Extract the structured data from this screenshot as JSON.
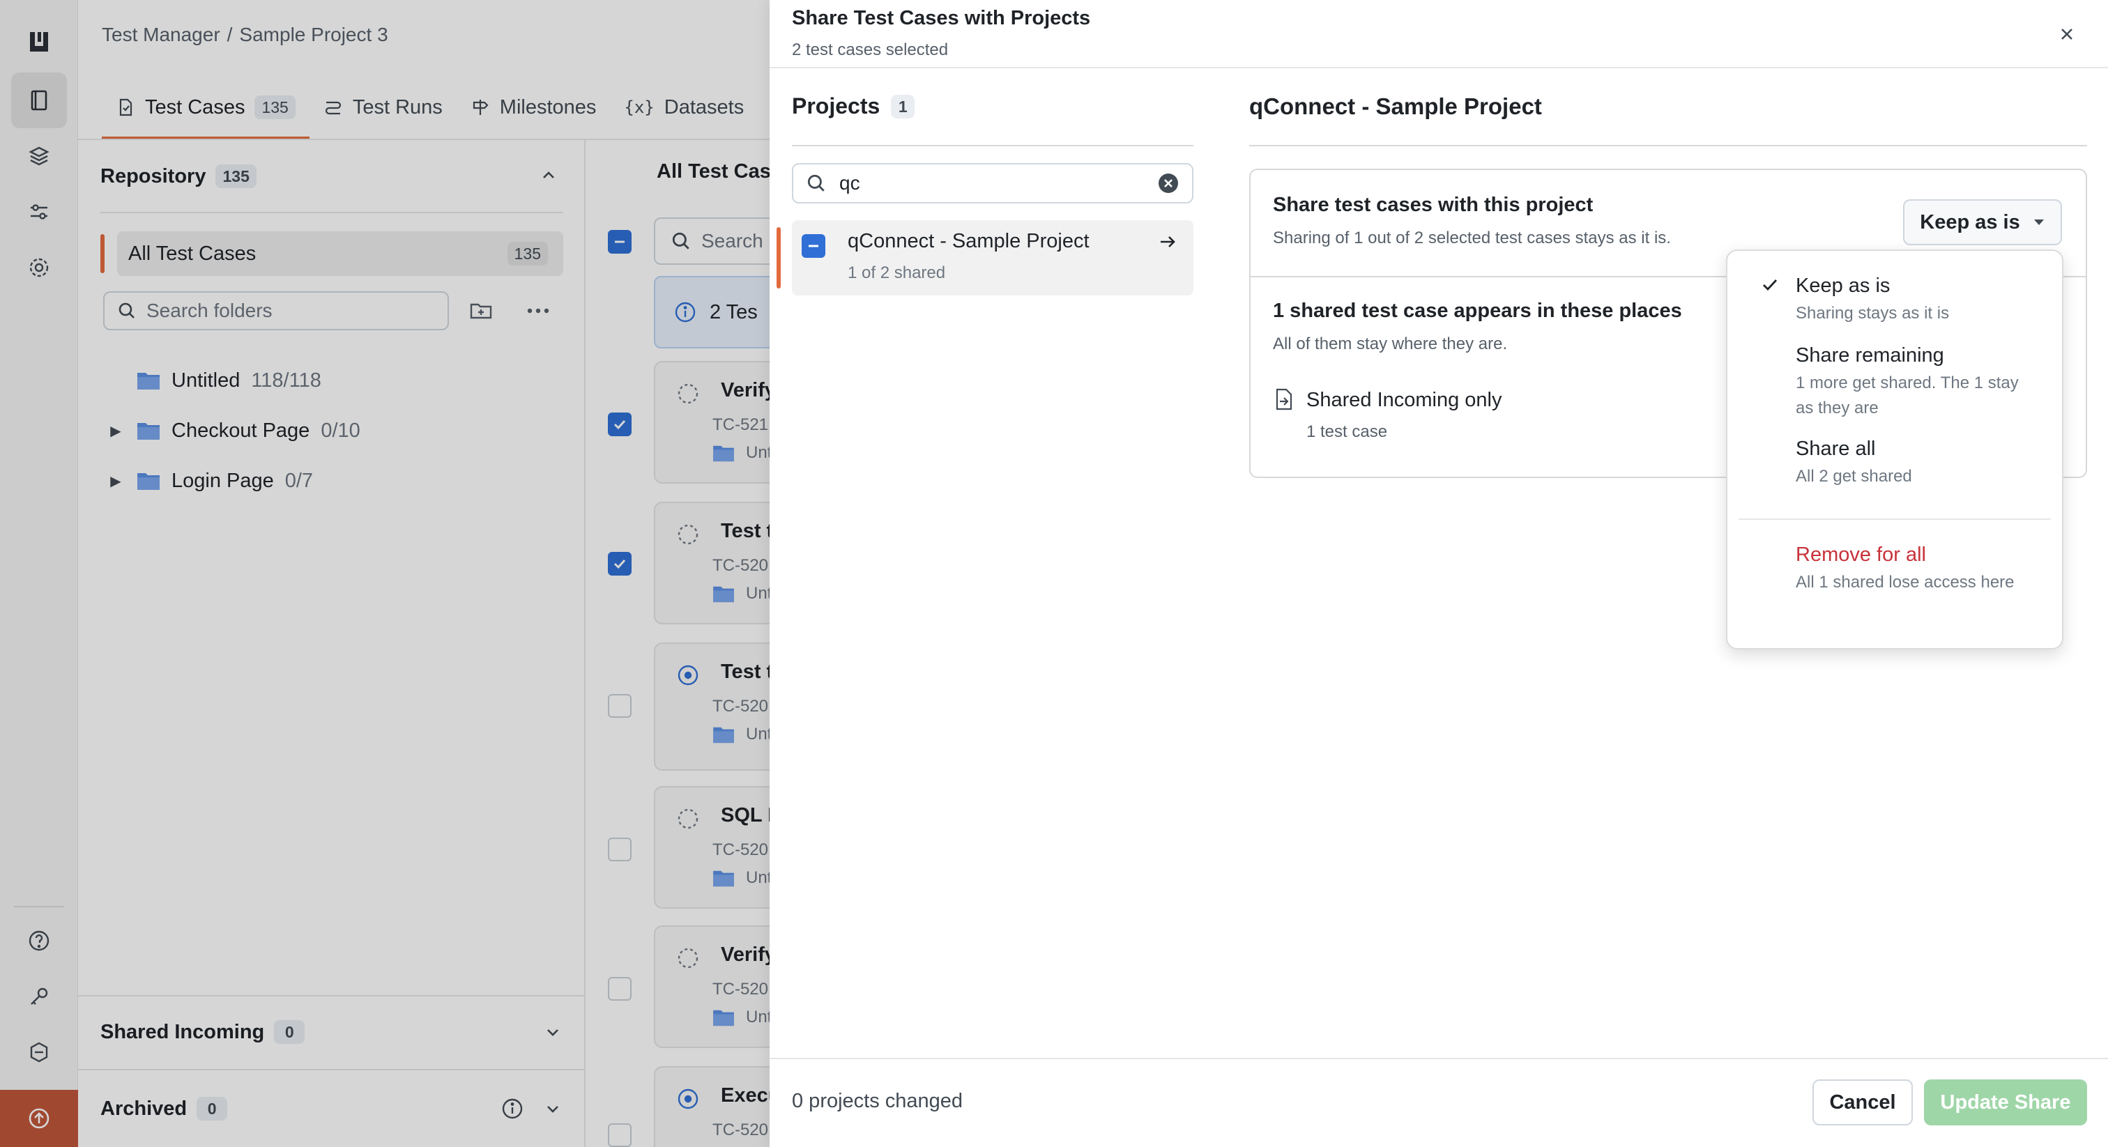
{
  "app": {
    "breadcrumb": [
      "Test Manager",
      "/",
      "Sample Project 3"
    ],
    "tabs": [
      {
        "label": "Test Cases",
        "count": "135"
      },
      {
        "label": "Test Runs"
      },
      {
        "label": "Milestones"
      },
      {
        "label": "Datasets"
      }
    ]
  },
  "sidebar": {
    "repository_label": "Repository",
    "repository_count": "135",
    "all_cases_label": "All Test Cases",
    "all_cases_count": "135",
    "search_placeholder": "Search folders",
    "folders": [
      {
        "name": "Untitled",
        "count": "118/118"
      },
      {
        "name": "Checkout Page",
        "count": "0/10"
      },
      {
        "name": "Login Page",
        "count": "0/7"
      }
    ],
    "shared_incoming_label": "Shared Incoming",
    "shared_incoming_count": "0",
    "archived_label": "Archived",
    "archived_count": "0"
  },
  "list": {
    "title": "All Test Case",
    "search_placeholder": "Search",
    "banner": "2 Tes",
    "cards": [
      {
        "title": "Verify",
        "id": "TC-521",
        "folder": "Unt"
      },
      {
        "title": "Test t",
        "id": "TC-520",
        "folder": "Unt"
      },
      {
        "title": "Test t",
        "id": "TC-520",
        "folder": "Unt"
      },
      {
        "title": "SQL I",
        "id": "TC-520",
        "folder": "Unt"
      },
      {
        "title": "Verify",
        "id": "TC-520",
        "folder": "Unt"
      },
      {
        "title": "Execu",
        "id": "TC-520",
        "folder": ""
      }
    ]
  },
  "modal": {
    "title": "Share Test Cases with Projects",
    "subtitle": "2 test cases selected",
    "projects_label": "Projects",
    "projects_count": "1",
    "search_value": "qc",
    "project_item": {
      "name": "qConnect - Sample Project",
      "meta": "1 of 2 shared"
    },
    "detail_title": "qConnect - Sample Project",
    "share_heading": "Share test cases with this project",
    "share_desc": "Sharing of 1 out of 2 selected test cases stays as it is.",
    "select_value": "Keep as is",
    "places_heading": "1 shared test case appears in these places",
    "places_desc": "All of them stay where they are.",
    "place_name": "Shared Incoming only",
    "place_meta": "1 test case",
    "footer_status": "0 projects changed",
    "cancel_label": "Cancel",
    "update_label": "Update Share",
    "colors": {
      "accent": "#e26a3c",
      "primary": "#2f6fd6",
      "update_disabled": "#9fd6a8",
      "danger": "#c8323a"
    }
  },
  "dropdown": {
    "options": [
      {
        "label": "Keep as is",
        "desc": "Sharing stays as it is",
        "selected": true
      },
      {
        "label": "Share remaining",
        "desc": "1 more get shared. The 1 stay as they are"
      },
      {
        "label": "Share all",
        "desc": "All 2 get shared"
      },
      {
        "label": "Remove for all",
        "desc": "All 1 shared lose access here",
        "danger": true
      }
    ]
  }
}
